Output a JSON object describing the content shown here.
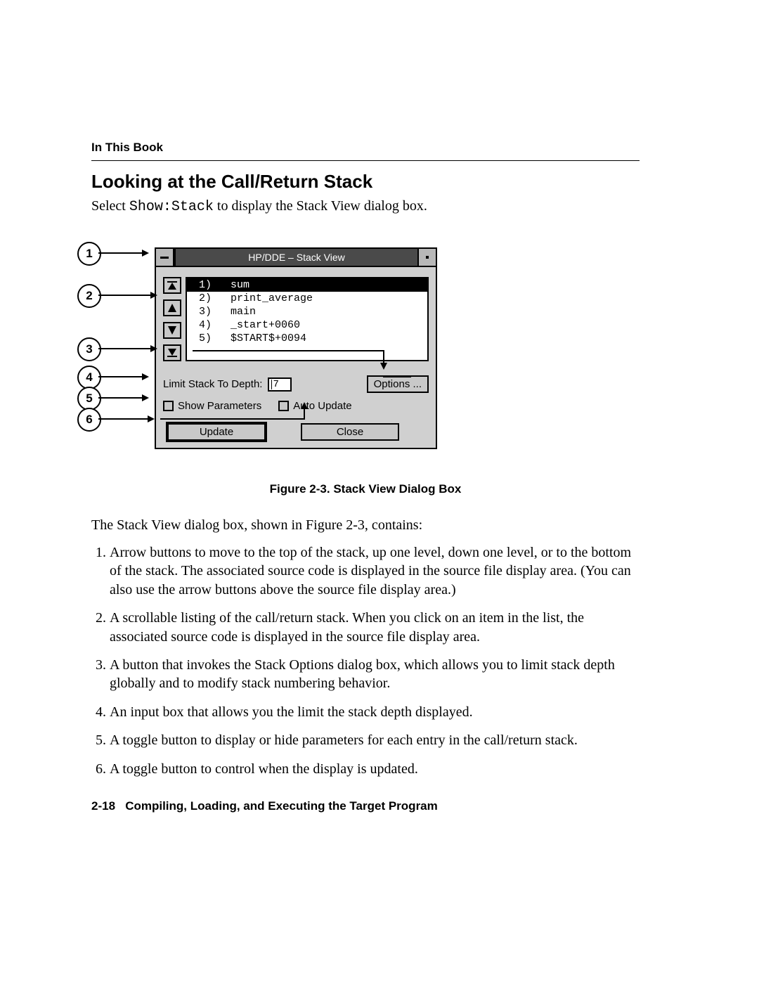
{
  "running_head": "In This Book",
  "section_title": "Looking at the Call/Return Stack",
  "intro_prefix": "Select ",
  "intro_code": "Show:Stack",
  "intro_suffix": " to display the Stack View dialog box.",
  "dialog": {
    "title": "HP/DDE – Stack View",
    "stack_rows": [
      {
        "n": "1)",
        "text": "sum",
        "selected": true
      },
      {
        "n": "2)",
        "text": "print_average",
        "selected": false
      },
      {
        "n": "3)",
        "text": "main",
        "selected": false
      },
      {
        "n": "4)",
        "text": "_start+0060",
        "selected": false
      },
      {
        "n": "5)",
        "text": "$START$+0094",
        "selected": false
      }
    ],
    "limit_label": "Limit Stack To Depth:",
    "limit_value": "7",
    "options_label": "Options ...",
    "show_params_label": "Show Parameters",
    "auto_update_label": "Auto Update",
    "update_label": "Update",
    "close_label": "Close"
  },
  "callout_labels": [
    "1",
    "2",
    "3",
    "4",
    "5",
    "6"
  ],
  "figure_caption": "Figure 2-3. Stack View Dialog Box",
  "lead": "The Stack View dialog box, shown in Figure 2-3, contains:",
  "items": [
    "Arrow buttons to move to the top of the stack, up one level, down one level, or to the bottom of the stack. The associated source code is displayed in the source file display area. (You can also use the arrow buttons above the source file display area.)",
    "A scrollable listing of the call/return stack. When you click on an item in the list, the associated source code is displayed in the source file display area.",
    "A button that invokes the Stack Options dialog box, which allows you to limit stack depth globally and to modify stack numbering behavior.",
    "An input box that allows you the limit the stack depth displayed.",
    "A toggle button to display or hide parameters for each entry in the call/return stack.",
    "A toggle button to control when the display is updated."
  ],
  "footer_page": "2-18",
  "footer_text": "Compiling, Loading, and Executing the Target Program"
}
